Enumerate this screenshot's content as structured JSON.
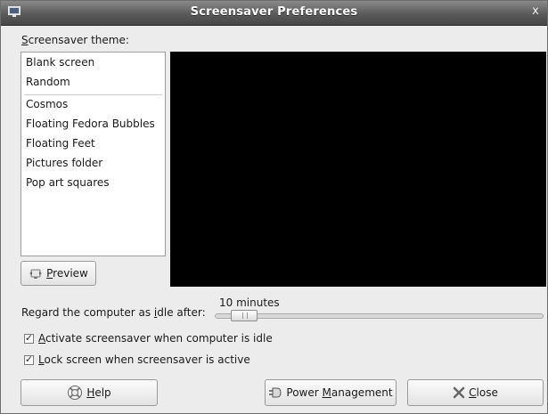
{
  "window": {
    "title": "Screensaver Preferences",
    "close_glyph": "x"
  },
  "theme": {
    "label_accel": "S",
    "label_rest": "creensaver theme:",
    "items": [
      "Blank screen",
      "Random",
      "Cosmos",
      "Floating Fedora Bubbles",
      "Floating Feet",
      "Pictures folder",
      "Pop art squares"
    ]
  },
  "preview_button": {
    "accel": "P",
    "rest": "review"
  },
  "idle": {
    "label_pre": "Regard the computer as ",
    "label_accel": "i",
    "label_post": "dle after:",
    "value": "10 minutes",
    "level": 0.08
  },
  "options": {
    "activate": {
      "accel": "A",
      "rest": "ctivate screensaver when computer is idle",
      "checked": true
    },
    "lock": {
      "accel": "L",
      "rest": "ock screen when screensaver is active",
      "checked": true
    }
  },
  "buttons": {
    "help": {
      "accel": "H",
      "rest": "elp"
    },
    "power": {
      "pre": "Power ",
      "accel": "M",
      "rest": "anagement"
    },
    "close": {
      "accel": "C",
      "rest": "lose"
    }
  },
  "icons": {
    "window": "monitor-icon",
    "preview": "preview-icon",
    "help": "help-lifebuoy-icon",
    "power": "power-plug-icon",
    "close": "close-x-icon"
  }
}
